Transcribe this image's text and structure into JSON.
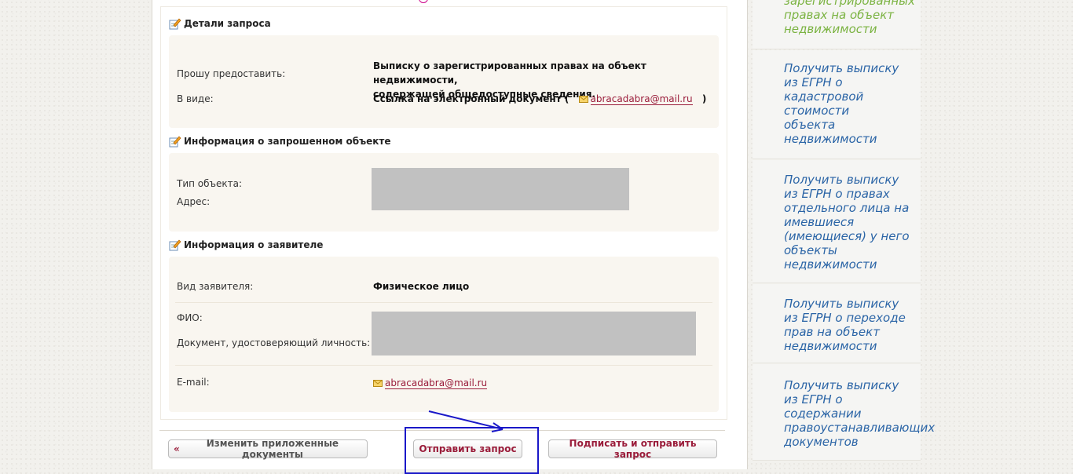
{
  "request_details": {
    "title": "Детали запроса",
    "provide_label": "Прошу предоставить:",
    "provide_value_line1": "Выписку о зарегистрированных правах на объект недвижимости,",
    "provide_value_line2": "содержащей общедоступные сведения.",
    "form_label": "В виде:",
    "form_value_prefix": "Ссылка на электронный документ (",
    "form_value_email": "abracadabra@mail.ru",
    "form_value_suffix": ")"
  },
  "object_info": {
    "title": "Информация о запрошенном объекте",
    "type_label": "Тип объекта:",
    "address_label": "Адрес:"
  },
  "applicant_info": {
    "title": "Информация о заявителе",
    "kind_label": "Вид заявителя:",
    "kind_value": "Физическое лицо",
    "fio_label": "ФИО:",
    "document_label": "Документ, удостоверяющий личность:",
    "email_label": "E-mail:",
    "email_value": "abracadabra@mail.ru"
  },
  "buttons": {
    "change_docs": "Изменить приложенные документы",
    "change_docs_icon": "«",
    "send": "Отправить запрос",
    "sign_send": "Подписать и отправить запрос"
  },
  "sidebar": {
    "items": [
      {
        "line1": "зарегистрированных",
        "line2": "правах на объект",
        "line3": "недвижимости"
      },
      {
        "text": [
          "Получить выписку",
          "из ЕГРН о",
          "кадастровой",
          "стоимости",
          "объекта",
          "недвижимости"
        ]
      },
      {
        "text": [
          "Получить выписку",
          "из ЕГРН о правах",
          "отдельного лица на",
          "имевшиеся",
          "(имеющиеся) у него",
          "объекты",
          "недвижимости"
        ]
      },
      {
        "text": [
          "Получить выписку",
          "из ЕГРН о переходе",
          "прав на объект",
          "недвижимости"
        ]
      },
      {
        "text": [
          "Получить выписку",
          "из ЕГРН о",
          "содержании",
          "правоустанавливающих",
          "документов"
        ]
      }
    ]
  },
  "colors": {
    "link": "#2a64a6",
    "active_link": "#7bb342",
    "accent_red": "#9a1c3a",
    "highlight": "#1a18c8"
  }
}
